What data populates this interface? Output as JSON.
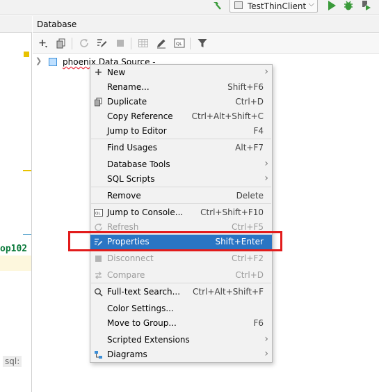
{
  "runbar": {
    "config_name": "TestThinClient",
    "icons": [
      "hammer-icon",
      "run-icon",
      "debug-icon",
      "coverage-icon"
    ]
  },
  "editor": {
    "code_fragment": "op102",
    "sql_tag": "sql:"
  },
  "db_panel": {
    "title": "Database",
    "toolbar_icons": [
      "add-icon",
      "duplicate-icon",
      "refresh-icon",
      "edit-properties-icon",
      "stop-icon",
      "table-icon",
      "edit-icon",
      "console-icon",
      "filter-icon"
    ],
    "tree_item": "phoenix Data Source -",
    "tree_item_squiggled": "phoenix"
  },
  "context_menu": {
    "selected_color": "#2a75c4",
    "items": [
      {
        "label": "New",
        "shortcut": "",
        "icon": "plus-icon",
        "submenu": true,
        "disabled": false
      },
      {
        "label": "Rename...",
        "shortcut": "Shift+F6",
        "icon": "",
        "submenu": false,
        "disabled": false
      },
      {
        "label": "Duplicate",
        "shortcut": "Ctrl+D",
        "icon": "duplicate-icon",
        "submenu": false,
        "disabled": false
      },
      {
        "label": "Copy Reference",
        "shortcut": "Ctrl+Alt+Shift+C",
        "icon": "",
        "submenu": false,
        "disabled": false
      },
      {
        "label": "Jump to Editor",
        "shortcut": "F4",
        "icon": "",
        "submenu": false,
        "disabled": false
      },
      {
        "label": "Find Usages",
        "shortcut": "Alt+F7",
        "icon": "",
        "submenu": false,
        "disabled": false
      },
      {
        "label": "Database Tools",
        "shortcut": "",
        "icon": "",
        "submenu": true,
        "disabled": false
      },
      {
        "label": "SQL Scripts",
        "shortcut": "",
        "icon": "",
        "submenu": true,
        "disabled": false
      },
      {
        "label": "Remove",
        "shortcut": "Delete",
        "icon": "",
        "submenu": false,
        "disabled": false
      },
      {
        "label": "Jump to Console...",
        "shortcut": "Ctrl+Shift+F10",
        "icon": "console-icon",
        "submenu": false,
        "disabled": false
      },
      {
        "label": "Refresh",
        "shortcut": "Ctrl+F5",
        "icon": "refresh-icon",
        "submenu": false,
        "disabled": true
      },
      {
        "label": "Properties",
        "shortcut": "Shift+Enter",
        "icon": "properties-icon",
        "submenu": false,
        "disabled": false,
        "selected": true
      },
      {
        "label": "Disconnect",
        "shortcut": "Ctrl+F2",
        "icon": "stop-icon",
        "submenu": false,
        "disabled": true
      },
      {
        "label": "Compare",
        "shortcut": "Ctrl+D",
        "icon": "compare-icon",
        "submenu": false,
        "disabled": true
      },
      {
        "label": "Full-text Search...",
        "shortcut": "Ctrl+Alt+Shift+F",
        "icon": "search-icon",
        "submenu": false,
        "disabled": false
      },
      {
        "label": "Color Settings...",
        "shortcut": "",
        "icon": "",
        "submenu": false,
        "disabled": false
      },
      {
        "label": "Move to Group...",
        "shortcut": "F6",
        "icon": "",
        "submenu": false,
        "disabled": false
      },
      {
        "label": "Scripted Extensions",
        "shortcut": "",
        "icon": "",
        "submenu": true,
        "disabled": false
      },
      {
        "label": "Diagrams",
        "shortcut": "",
        "icon": "diagram-icon",
        "submenu": true,
        "disabled": false
      }
    ]
  }
}
